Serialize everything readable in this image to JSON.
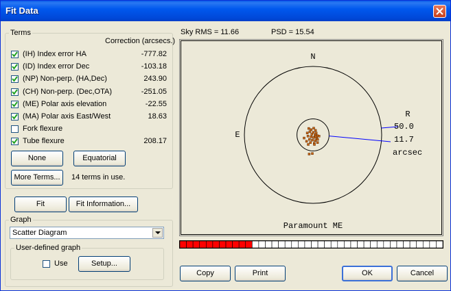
{
  "window": {
    "title": "Fit Data"
  },
  "terms": {
    "group_label": "Terms",
    "correction_header": "Correction (arcsecs.)",
    "items": [
      {
        "label": "(IH) Index error HA",
        "value": "-777.82",
        "checked": true
      },
      {
        "label": "(ID) Index error Dec",
        "value": "-103.18",
        "checked": true
      },
      {
        "label": "(NP) Non-perp. (HA,Dec)",
        "value": "243.90",
        "checked": true
      },
      {
        "label": "(CH) Non-perp. (Dec,OTA)",
        "value": "-251.05",
        "checked": true
      },
      {
        "label": "(ME) Polar axis elevation",
        "value": "-22.55",
        "checked": true
      },
      {
        "label": "(MA) Polar axis East/West",
        "value": "18.63",
        "checked": true
      },
      {
        "label": "Fork flexure",
        "value": "",
        "checked": false
      },
      {
        "label": "Tube flexure",
        "value": "208.17",
        "checked": true
      }
    ],
    "none_button": "None",
    "equatorial_button": "Equatorial",
    "more_terms_button": "More Terms...",
    "terms_in_use": "14 terms in use."
  },
  "fit_button": "Fit",
  "fit_info_button": "Fit Information...",
  "graph": {
    "group_label": "Graph",
    "selected": "Scatter Diagram",
    "user_group_label": "User-defined graph",
    "use_label": "Use",
    "use_checked": false,
    "setup_button": "Setup..."
  },
  "stats": {
    "sky_rms": "Sky RMS = 11.66",
    "psd": "PSD = 15.54"
  },
  "plot": {
    "north": "N",
    "east": "E",
    "radius_label": "R",
    "outer_radius": "50.0",
    "inner_radius": "11.7",
    "units": "arcsec",
    "footer": "Paramount ME",
    "point_color": "#c86414",
    "points": [
      [
        -3.1,
        4.7
      ],
      [
        -1.4,
        3.8
      ],
      [
        0.5,
        4.9
      ],
      [
        1.8,
        3.3
      ],
      [
        -2.3,
        2.3
      ],
      [
        0.2,
        1.9
      ],
      [
        2.3,
        1.4
      ],
      [
        -4.2,
        1.4
      ],
      [
        -0.9,
        0.5
      ],
      [
        1.4,
        0.0
      ],
      [
        3.0,
        -0.5
      ],
      [
        -3.7,
        -0.9
      ],
      [
        -1.4,
        -1.4
      ],
      [
        0.5,
        -1.9
      ],
      [
        2.6,
        -2.3
      ],
      [
        -2.6,
        -3.3
      ],
      [
        -0.5,
        -3.8
      ],
      [
        1.6,
        -4.2
      ],
      [
        3.4,
        -3.3
      ],
      [
        -6.5,
        -2.3
      ],
      [
        -1.9,
        -5.6
      ],
      [
        0.9,
        -6.1
      ],
      [
        3.3,
        -5.6
      ],
      [
        -0.5,
        -13.6
      ],
      [
        -2.8,
        -14.0
      ],
      [
        1.0,
        -7.0
      ],
      [
        -3.5,
        -7.0
      ],
      [
        2.1,
        -1.2
      ],
      [
        -4.7,
        -4.7
      ],
      [
        4.4,
        -0.9
      ]
    ]
  },
  "progress": {
    "fraction": 0.27,
    "segments": 40,
    "fill_color": "#ff0000"
  },
  "footer": {
    "copy": "Copy",
    "print": "Print",
    "ok": "OK",
    "cancel": "Cancel"
  }
}
